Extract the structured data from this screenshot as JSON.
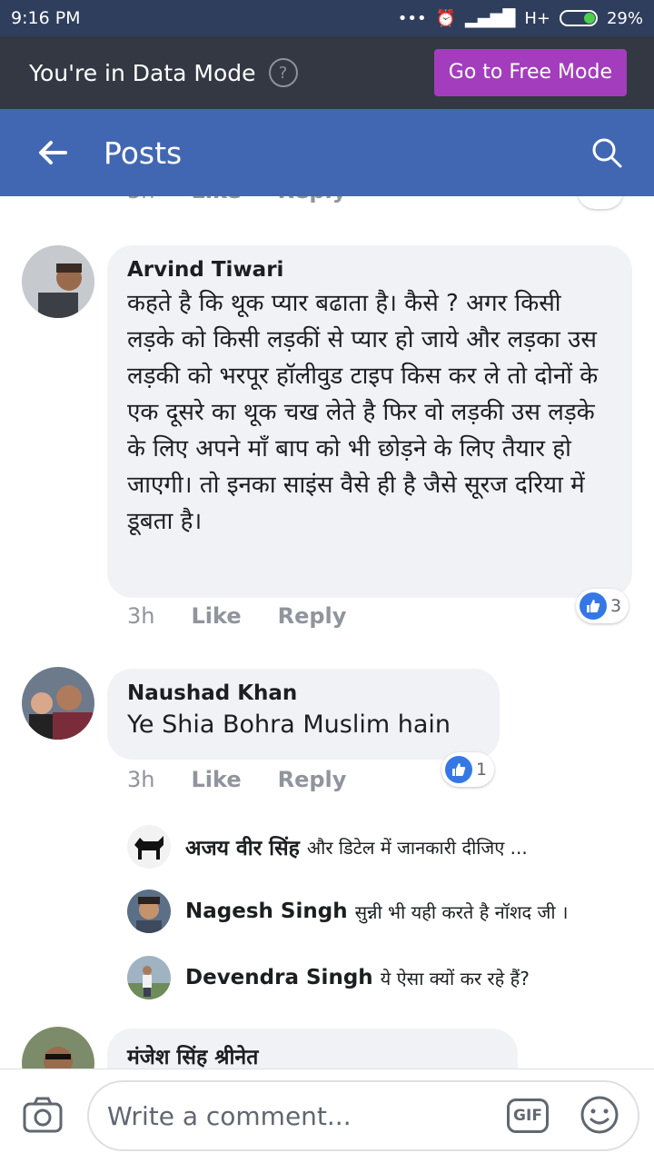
{
  "status_bar": {
    "time": "9:16 PM",
    "network": "H+",
    "battery": "29%"
  },
  "data_mode": {
    "text": "You're in Data Mode",
    "help": "?",
    "button": "Go to Free Mode"
  },
  "app_bar": {
    "title": "Posts"
  },
  "top_partial": {
    "time": "3h",
    "like": "Like",
    "reply": "Reply"
  },
  "comments": [
    {
      "author": "Arvind Tiwari",
      "text": "कहते है कि थूक प्यार बढाता है। कैसे ? अगर किसी लड़के को किसी लड़कीं से प्यार हो जाये और लड़का उस लड़की को भरपूर हॉलीवुड टाइप किस कर ले तो दोनों के  एक दूसरे का थूक चख लेते है फिर वो लड़की उस लड़के के लिए अपने माँ बाप को भी छोड़ने के लिए तैयार हो जाएगी।  तो इनका साइंस वैसे ही है जैसे सूरज दरिया में डूबता है।",
      "time": "3h",
      "like": "Like",
      "reply": "Reply",
      "reactions": "3"
    },
    {
      "author": "Naushad Khan",
      "text": "Ye Shia Bohra Muslim hain",
      "time": "3h",
      "like": "Like",
      "reply": "Reply",
      "reactions": "1",
      "replies": [
        {
          "author": "अजय वीर सिंह",
          "text": "और डिटेल में जानकारी दीजिए  ..."
        },
        {
          "author": "Nagesh Singh",
          "text": "सुन्नी भी यही करते है नॉशद जी ।"
        },
        {
          "author": "Devendra Singh",
          "text": "ये ऐसा क्यों कर रहे हैं?"
        }
      ]
    },
    {
      "author": "मंजेश सिंह श्रीनेत"
    }
  ],
  "composer": {
    "placeholder": "Write a comment...",
    "gif": "GIF"
  },
  "colors": {
    "brand": "#4267b2",
    "free_mode": "#a33dbd",
    "like": "#3578e5"
  },
  "icons": [
    "back-arrow-icon",
    "search-icon",
    "camera-icon",
    "gif-icon",
    "emoji-icon",
    "like-icon",
    "help-icon"
  ]
}
